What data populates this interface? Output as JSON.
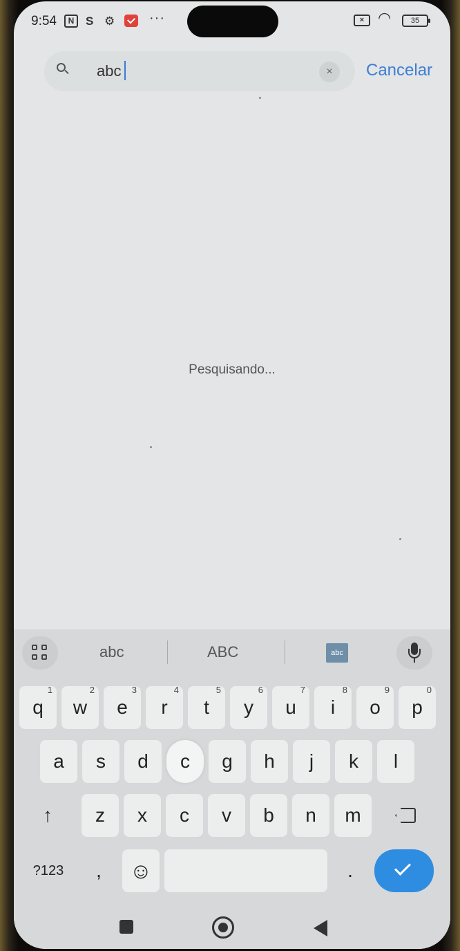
{
  "status_bar": {
    "time": "9:54",
    "battery": "35",
    "icons": [
      "nfc-icon",
      "s-icon",
      "gear-icon",
      "mail-icon",
      "more-icon",
      "sim-off-icon",
      "wifi-icon",
      "battery-icon"
    ]
  },
  "search": {
    "value": "abc",
    "cancel_label": "Cancelar",
    "clear_glyph": "×"
  },
  "results": {
    "status_text": "Pesquisando..."
  },
  "keyboard": {
    "suggestions": [
      "abc",
      "ABC"
    ],
    "abc_chip": "abc",
    "row1": [
      {
        "k": "q",
        "n": "1"
      },
      {
        "k": "w",
        "n": "2"
      },
      {
        "k": "e",
        "n": "3"
      },
      {
        "k": "r",
        "n": "4"
      },
      {
        "k": "t",
        "n": "5"
      },
      {
        "k": "y",
        "n": "6"
      },
      {
        "k": "u",
        "n": "7"
      },
      {
        "k": "i",
        "n": "8"
      },
      {
        "k": "o",
        "n": "9"
      },
      {
        "k": "p",
        "n": "0"
      }
    ],
    "row2": [
      "a",
      "s",
      "d",
      "c",
      "g",
      "h",
      "j",
      "k",
      "l"
    ],
    "row3": [
      "z",
      "x",
      "c",
      "v",
      "b",
      "n",
      "m"
    ],
    "shift_glyph": "↑",
    "symbols_label": "?123",
    "comma": ",",
    "emoji_glyph": "☺",
    "period": ".",
    "popup_key": "c"
  }
}
